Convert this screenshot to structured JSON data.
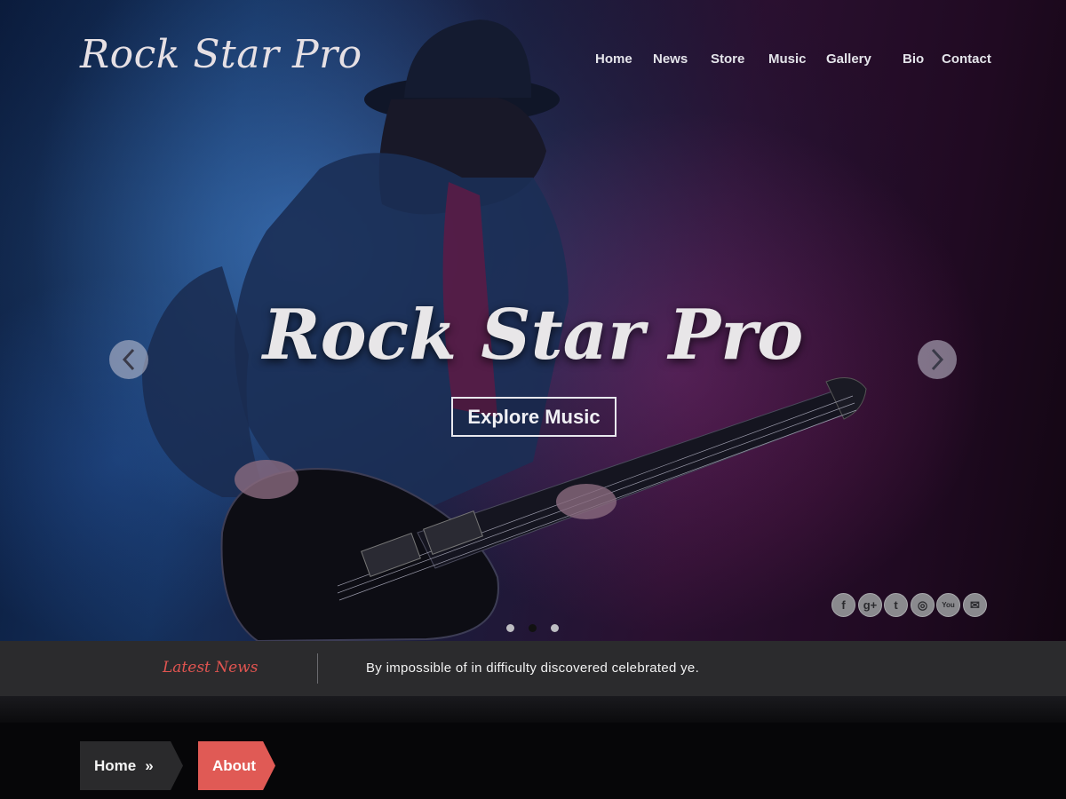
{
  "brand": {
    "logo": "Rock Star Pro"
  },
  "nav": {
    "items": [
      {
        "label": "Home"
      },
      {
        "label": "News"
      },
      {
        "label": "Store"
      },
      {
        "label": "Music"
      },
      {
        "label": "Gallery"
      },
      {
        "label": "Bio"
      },
      {
        "label": "Contact"
      }
    ]
  },
  "hero": {
    "title": "Rock Star Pro",
    "cta_label": "Explore Music",
    "slides": {
      "count": 3,
      "active": 2
    }
  },
  "social": {
    "icons": [
      {
        "name": "facebook-icon",
        "glyph": "f"
      },
      {
        "name": "google-plus-icon",
        "glyph": "g+"
      },
      {
        "name": "twitter-icon",
        "glyph": "t"
      },
      {
        "name": "instagram-icon",
        "glyph": "◎"
      },
      {
        "name": "youtube-icon",
        "glyph": "You"
      },
      {
        "name": "mail-icon",
        "glyph": "✉"
      }
    ]
  },
  "ticker": {
    "label": "Latest News",
    "text": "By impossible of in difficulty discovered celebrated ye."
  },
  "breadcrumb": {
    "home": "Home",
    "separator": "»",
    "current": "About"
  },
  "colors": {
    "accent": "#e05a55",
    "ticker_bg": "#2b2b2d",
    "page_bg": "#060608"
  }
}
